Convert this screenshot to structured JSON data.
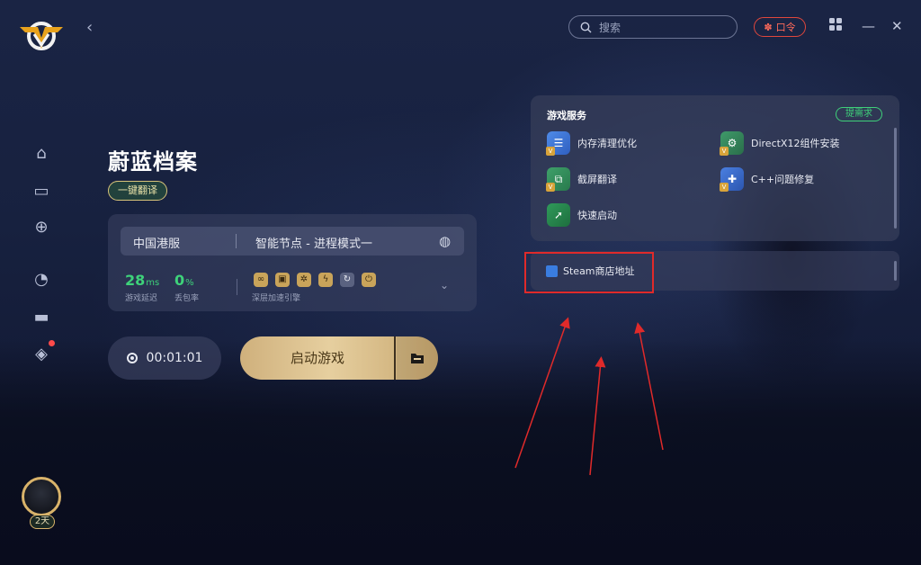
{
  "game": {
    "title": "蔚蓝档案",
    "translate_label": "一键翻译"
  },
  "header": {
    "search_placeholder": "搜索",
    "kouling_label": "口令"
  },
  "connection": {
    "region": "中国港服",
    "node": "智能节点 - 进程模式一",
    "latency_value": "28",
    "latency_unit": "ms",
    "latency_label": "游戏延迟",
    "loss_value": "0",
    "loss_unit": "%",
    "loss_label": "丢包率",
    "accel_label": "深层加速引擎"
  },
  "launch": {
    "timer": "00:01:01",
    "launch_label": "启动游戏"
  },
  "services": {
    "title": "游戏服务",
    "request_label": "提需求",
    "items": [
      {
        "label": "内存清理优化"
      },
      {
        "label": "DirectX12组件安装"
      },
      {
        "label": "截屏翻译"
      },
      {
        "label": "C++问题修复"
      },
      {
        "label": "快速启动"
      }
    ],
    "steam_label": "Steam商店地址"
  },
  "user": {
    "days_badge": "2天"
  },
  "colors": {
    "accent_green": "#3ed27a",
    "gold": "#d9b36a",
    "highlight_red": "#e02a2a"
  }
}
